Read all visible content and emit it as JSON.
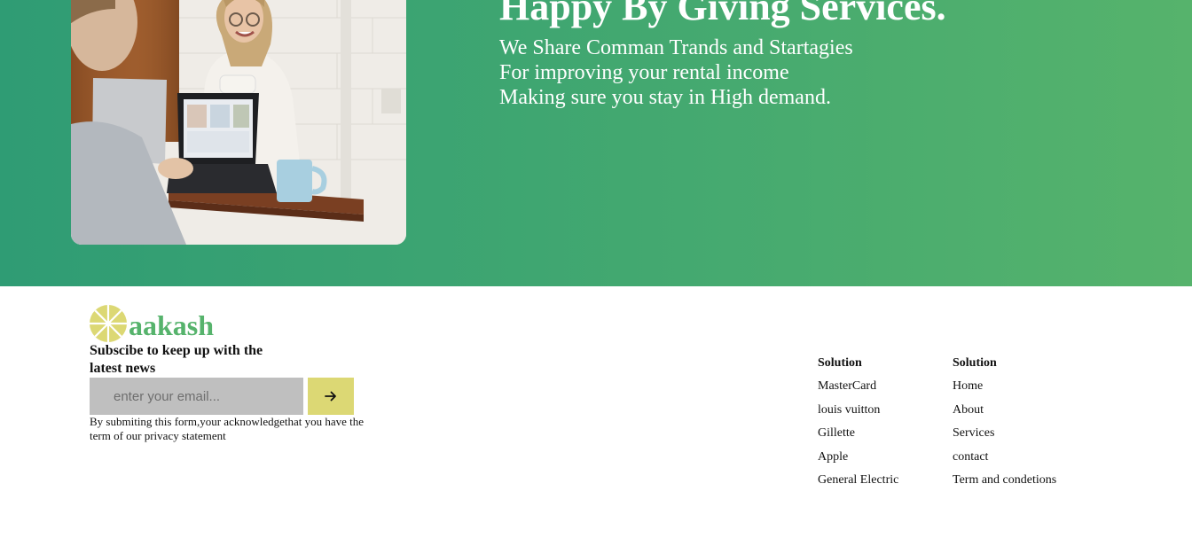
{
  "hero": {
    "title": "Happy By Giving Services.",
    "lines": [
      "We Share Comman Trands and Startagies",
      "For improving your rental income",
      "Making sure you stay in High demand."
    ]
  },
  "brand": {
    "name": "aakash",
    "logo_icon": "lemon-slice-icon",
    "logo_color": "#dcd874",
    "name_color": "#56b36c"
  },
  "subscribe": {
    "title": "Subscibe to keep up with the latest news",
    "placeholder": "enter your email...",
    "submit_icon": "arrow-right-icon",
    "disclaimer": "By submiting this form,your acknowledgethat you have the term of our privacy statement"
  },
  "footer_columns": [
    {
      "heading": "Solution",
      "links": [
        "MasterCard",
        "louis vuitton",
        "Gillette",
        "Apple",
        "General Electric"
      ]
    },
    {
      "heading": "Solution",
      "links": [
        "Home",
        "About",
        "Services",
        "contact",
        "Term and condetions"
      ]
    }
  ],
  "colors": {
    "hero_gradient_start": "#2f9c74",
    "hero_gradient_end": "#56b36c",
    "button": "#dcd874",
    "input": "#bfbfbf"
  }
}
